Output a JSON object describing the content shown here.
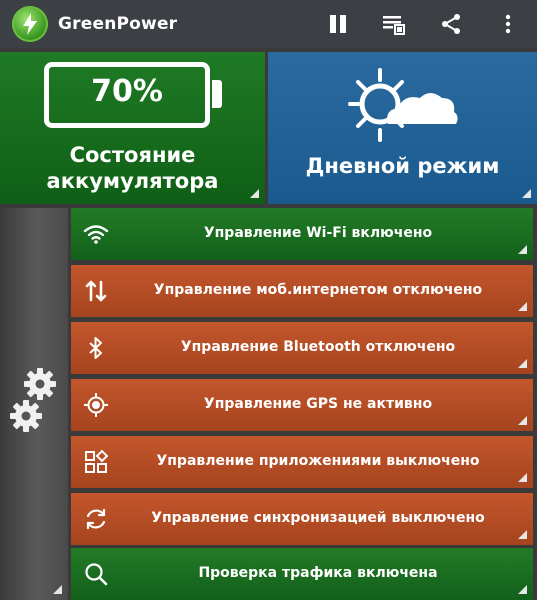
{
  "app": {
    "title": "GreenPower"
  },
  "appbar_icons": [
    "pause-icon",
    "playlist-icon",
    "share-icon",
    "more-vert-icon"
  ],
  "battery": {
    "value": "70%",
    "label_line1": "Состояние",
    "label_line2": "аккумулятора"
  },
  "mode": {
    "label": "Дневной режим",
    "icon": "day-weather-icon"
  },
  "settings_icon": "gears-icon",
  "rows": [
    {
      "label": "Управление Wi-Fi включено",
      "icon": "wifi-icon",
      "status": "on"
    },
    {
      "label": "Управление моб.интернетом отключено",
      "icon": "data-arrows-icon",
      "status": "off"
    },
    {
      "label": "Управление Bluetooth отключено",
      "icon": "bluetooth-icon",
      "status": "off"
    },
    {
      "label": "Управление GPS не активно",
      "icon": "gps-icon",
      "status": "off"
    },
    {
      "label": "Управление приложениями выключено",
      "icon": "apps-icon",
      "status": "off"
    },
    {
      "label": "Управление синхронизацией выключено",
      "icon": "sync-icon",
      "status": "off"
    },
    {
      "label": "Проверка трафика включена",
      "icon": "search-icon",
      "status": "on"
    }
  ],
  "colors": {
    "on": "#1f7a24",
    "off": "#b84d25",
    "mode_tile": "#1f6396",
    "appbar": "#3c3f43"
  }
}
